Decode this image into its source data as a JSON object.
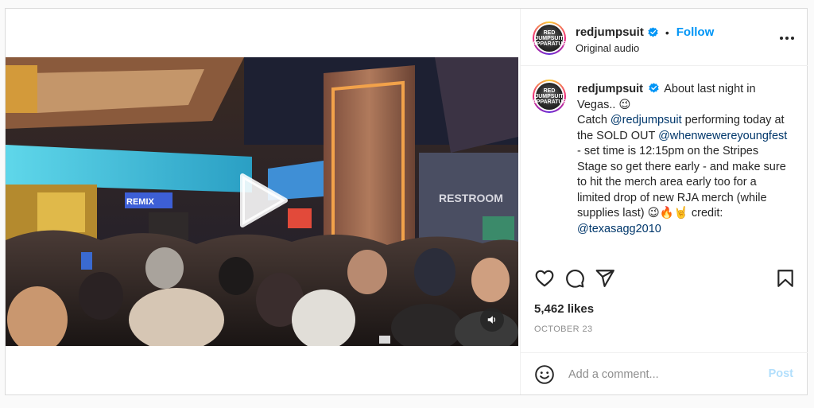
{
  "header": {
    "username": "redjumpsuit",
    "verified": true,
    "separator": "•",
    "follow_label": "Follow",
    "audio_label": "Original audio",
    "avatar_text": "RED JUMPSUIT APPARATUS"
  },
  "caption": {
    "username": "redjumpsuit",
    "line1": "About last night in Vegas.. 😉",
    "line2_pre": "Catch",
    "mention1": "@redjumpsuit",
    "line2_post": "performing today at the SOLD OUT",
    "mention2": "@whenwewereyoungfest",
    "line3": "- set time is 12:15pm on the Stripes Stage so get there early - and make sure to hit the merch area early too for a limited drop of new RJA merch (while supplies last) 😉🔥🤘 credit:",
    "mention3": "@texasagg2010"
  },
  "media": {
    "sign_text": "RESTROOM",
    "sign2_text": "REMIX",
    "icons": [
      "play-icon",
      "speaker-icon"
    ]
  },
  "actions": {
    "icons": [
      "heart-icon",
      "comment-icon",
      "share-icon",
      "bookmark-icon"
    ]
  },
  "likes": "5,462 likes",
  "date": "OCTOBER 23",
  "comment": {
    "placeholder": "Add a comment...",
    "post_label": "Post"
  },
  "colors": {
    "accent": "#0095f6",
    "post_disabled": "#b2dffc",
    "mention": "#00376b",
    "muted": "#8e8e8e"
  }
}
